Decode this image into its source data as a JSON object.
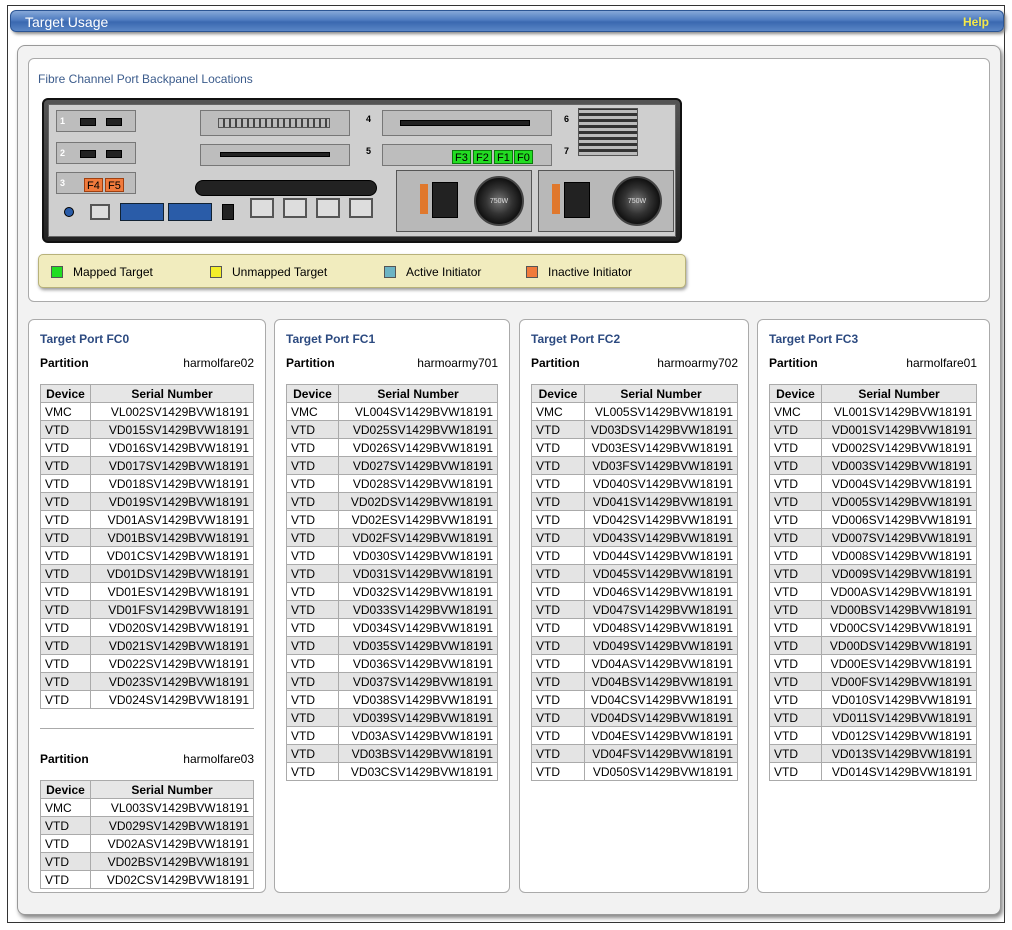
{
  "header": {
    "title": "Target Usage",
    "help": "Help"
  },
  "backpanel": {
    "title": "Fibre Channel Port Backpanel Locations",
    "slot_numbers": [
      "1",
      "2",
      "3",
      "4",
      "5",
      "6",
      "7"
    ],
    "fc_labels_green": [
      "F3",
      "F2",
      "F1",
      "F0"
    ],
    "fc_labels_orange": [
      "F4",
      "F5"
    ],
    "psu_label": "750W"
  },
  "legend": {
    "items": [
      {
        "label": "Mapped Target",
        "color": "#22dd22"
      },
      {
        "label": "Unmapped Target",
        "color": "#f4ee2a"
      },
      {
        "label": "Active Initiator",
        "color": "#6cb4c4"
      },
      {
        "label": "Inactive Initiator",
        "color": "#f07a3c"
      }
    ]
  },
  "columns": {
    "device": "Device",
    "serial": "Serial Number"
  },
  "partition_label": "Partition",
  "ports": [
    {
      "title": "Target Port FC0",
      "partitions": [
        {
          "name": "harmolfare02",
          "rows": [
            [
              "VMC",
              "VL002SV1429BVW18191"
            ],
            [
              "VTD",
              "VD015SV1429BVW18191"
            ],
            [
              "VTD",
              "VD016SV1429BVW18191"
            ],
            [
              "VTD",
              "VD017SV1429BVW18191"
            ],
            [
              "VTD",
              "VD018SV1429BVW18191"
            ],
            [
              "VTD",
              "VD019SV1429BVW18191"
            ],
            [
              "VTD",
              "VD01ASV1429BVW18191"
            ],
            [
              "VTD",
              "VD01BSV1429BVW18191"
            ],
            [
              "VTD",
              "VD01CSV1429BVW18191"
            ],
            [
              "VTD",
              "VD01DSV1429BVW18191"
            ],
            [
              "VTD",
              "VD01ESV1429BVW18191"
            ],
            [
              "VTD",
              "VD01FSV1429BVW18191"
            ],
            [
              "VTD",
              "VD020SV1429BVW18191"
            ],
            [
              "VTD",
              "VD021SV1429BVW18191"
            ],
            [
              "VTD",
              "VD022SV1429BVW18191"
            ],
            [
              "VTD",
              "VD023SV1429BVW18191"
            ],
            [
              "VTD",
              "VD024SV1429BVW18191"
            ]
          ]
        },
        {
          "name": "harmolfare03",
          "rows": [
            [
              "VMC",
              "VL003SV1429BVW18191"
            ],
            [
              "VTD",
              "VD029SV1429BVW18191"
            ],
            [
              "VTD",
              "VD02ASV1429BVW18191"
            ],
            [
              "VTD",
              "VD02BSV1429BVW18191"
            ],
            [
              "VTD",
              "VD02CSV1429BVW18191"
            ]
          ]
        }
      ]
    },
    {
      "title": "Target Port FC1",
      "partitions": [
        {
          "name": "harmoarmy701",
          "rows": [
            [
              "VMC",
              "VL004SV1429BVW18191"
            ],
            [
              "VTD",
              "VD025SV1429BVW18191"
            ],
            [
              "VTD",
              "VD026SV1429BVW18191"
            ],
            [
              "VTD",
              "VD027SV1429BVW18191"
            ],
            [
              "VTD",
              "VD028SV1429BVW18191"
            ],
            [
              "VTD",
              "VD02DSV1429BVW18191"
            ],
            [
              "VTD",
              "VD02ESV1429BVW18191"
            ],
            [
              "VTD",
              "VD02FSV1429BVW18191"
            ],
            [
              "VTD",
              "VD030SV1429BVW18191"
            ],
            [
              "VTD",
              "VD031SV1429BVW18191"
            ],
            [
              "VTD",
              "VD032SV1429BVW18191"
            ],
            [
              "VTD",
              "VD033SV1429BVW18191"
            ],
            [
              "VTD",
              "VD034SV1429BVW18191"
            ],
            [
              "VTD",
              "VD035SV1429BVW18191"
            ],
            [
              "VTD",
              "VD036SV1429BVW18191"
            ],
            [
              "VTD",
              "VD037SV1429BVW18191"
            ],
            [
              "VTD",
              "VD038SV1429BVW18191"
            ],
            [
              "VTD",
              "VD039SV1429BVW18191"
            ],
            [
              "VTD",
              "VD03ASV1429BVW18191"
            ],
            [
              "VTD",
              "VD03BSV1429BVW18191"
            ],
            [
              "VTD",
              "VD03CSV1429BVW18191"
            ]
          ]
        }
      ]
    },
    {
      "title": "Target Port FC2",
      "partitions": [
        {
          "name": "harmoarmy702",
          "rows": [
            [
              "VMC",
              "VL005SV1429BVW18191"
            ],
            [
              "VTD",
              "VD03DSV1429BVW18191"
            ],
            [
              "VTD",
              "VD03ESV1429BVW18191"
            ],
            [
              "VTD",
              "VD03FSV1429BVW18191"
            ],
            [
              "VTD",
              "VD040SV1429BVW18191"
            ],
            [
              "VTD",
              "VD041SV1429BVW18191"
            ],
            [
              "VTD",
              "VD042SV1429BVW18191"
            ],
            [
              "VTD",
              "VD043SV1429BVW18191"
            ],
            [
              "VTD",
              "VD044SV1429BVW18191"
            ],
            [
              "VTD",
              "VD045SV1429BVW18191"
            ],
            [
              "VTD",
              "VD046SV1429BVW18191"
            ],
            [
              "VTD",
              "VD047SV1429BVW18191"
            ],
            [
              "VTD",
              "VD048SV1429BVW18191"
            ],
            [
              "VTD",
              "VD049SV1429BVW18191"
            ],
            [
              "VTD",
              "VD04ASV1429BVW18191"
            ],
            [
              "VTD",
              "VD04BSV1429BVW18191"
            ],
            [
              "VTD",
              "VD04CSV1429BVW18191"
            ],
            [
              "VTD",
              "VD04DSV1429BVW18191"
            ],
            [
              "VTD",
              "VD04ESV1429BVW18191"
            ],
            [
              "VTD",
              "VD04FSV1429BVW18191"
            ],
            [
              "VTD",
              "VD050SV1429BVW18191"
            ]
          ]
        }
      ]
    },
    {
      "title": "Target Port FC3",
      "partitions": [
        {
          "name": "harmolfare01",
          "rows": [
            [
              "VMC",
              "VL001SV1429BVW18191"
            ],
            [
              "VTD",
              "VD001SV1429BVW18191"
            ],
            [
              "VTD",
              "VD002SV1429BVW18191"
            ],
            [
              "VTD",
              "VD003SV1429BVW18191"
            ],
            [
              "VTD",
              "VD004SV1429BVW18191"
            ],
            [
              "VTD",
              "VD005SV1429BVW18191"
            ],
            [
              "VTD",
              "VD006SV1429BVW18191"
            ],
            [
              "VTD",
              "VD007SV1429BVW18191"
            ],
            [
              "VTD",
              "VD008SV1429BVW18191"
            ],
            [
              "VTD",
              "VD009SV1429BVW18191"
            ],
            [
              "VTD",
              "VD00ASV1429BVW18191"
            ],
            [
              "VTD",
              "VD00BSV1429BVW18191"
            ],
            [
              "VTD",
              "VD00CSV1429BVW18191"
            ],
            [
              "VTD",
              "VD00DSV1429BVW18191"
            ],
            [
              "VTD",
              "VD00ESV1429BVW18191"
            ],
            [
              "VTD",
              "VD00FSV1429BVW18191"
            ],
            [
              "VTD",
              "VD010SV1429BVW18191"
            ],
            [
              "VTD",
              "VD011SV1429BVW18191"
            ],
            [
              "VTD",
              "VD012SV1429BVW18191"
            ],
            [
              "VTD",
              "VD013SV1429BVW18191"
            ],
            [
              "VTD",
              "VD014SV1429BVW18191"
            ]
          ]
        }
      ]
    }
  ]
}
